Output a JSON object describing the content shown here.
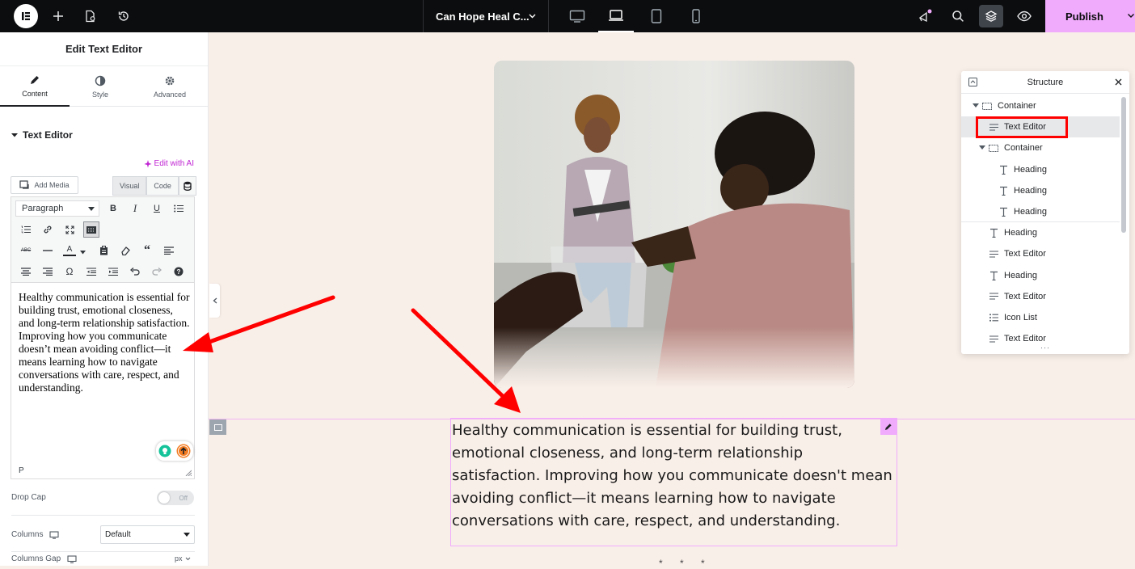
{
  "topbar": {
    "page_title": "Can Hope Heal C...",
    "publish_label": "Publish",
    "icons": [
      "elementor-logo-icon",
      "plus-icon",
      "page-settings-icon",
      "history-icon",
      "desktop-icon",
      "laptop-icon",
      "tablet-icon",
      "mobile-icon",
      "whats-new-icon",
      "search-icon",
      "structure-layers-icon",
      "preview-eye-icon",
      "chevron-down-icon"
    ],
    "active_device": "laptop"
  },
  "panel": {
    "title": "Edit Text Editor",
    "tabs": [
      {
        "label": "Content",
        "icon": "pencil-icon",
        "active": true
      },
      {
        "label": "Style",
        "icon": "half-circle-icon",
        "active": false
      },
      {
        "label": "Advanced",
        "icon": "gear-icon",
        "active": false
      }
    ],
    "section_title": "Text Editor",
    "edit_ai_label": "Edit with AI",
    "add_media_label": "Add Media",
    "visual_label": "Visual",
    "code_label": "Code",
    "format_select": "Paragraph",
    "editor_text": "Healthy communication is essential for building trust, emotional closeness, and long-term relationship satisfaction. Improving how you communicate doesn’t mean avoiding conflict—it means learning how to navigate conversations with care, respect, and understanding.",
    "editor_path": "P",
    "drop_cap_label": "Drop Cap",
    "drop_cap_value": "Off",
    "columns_label": "Columns",
    "columns_value": "Default",
    "columns_gap_label": "Columns Gap",
    "columns_gap_unit": "px"
  },
  "canvas": {
    "text": "Healthy communication is essential for building trust, emotional closeness, and long-term relationship satisfaction. Improving how you communicate doesn't mean avoiding conflict—it means learning how to navigate conversations with care, respect, and understanding.",
    "divider": "* * *"
  },
  "navigator": {
    "title": "Structure",
    "items": [
      {
        "label": "Container",
        "type": "container",
        "level": 0
      },
      {
        "label": "Text Editor",
        "type": "text",
        "level": 1,
        "selected": true
      },
      {
        "label": "Container",
        "type": "container",
        "level": 1
      },
      {
        "label": "Heading",
        "type": "heading",
        "level": 2
      },
      {
        "label": "Heading",
        "type": "heading",
        "level": 2
      },
      {
        "label": "Heading",
        "type": "heading",
        "level": 2
      },
      {
        "label": "Heading",
        "type": "heading",
        "level": 1
      },
      {
        "label": "Text Editor",
        "type": "text",
        "level": 1
      },
      {
        "label": "Heading",
        "type": "heading",
        "level": 1
      },
      {
        "label": "Text Editor",
        "type": "text",
        "level": 1
      },
      {
        "label": "Icon List",
        "type": "list",
        "level": 1
      },
      {
        "label": "Text Editor",
        "type": "text",
        "level": 1
      }
    ]
  },
  "colors": {
    "accent": "#f0abfc",
    "annotation_red": "#ff0000",
    "canvas_bg": "#f9efe9",
    "topbar_bg": "#0c0d0e"
  }
}
